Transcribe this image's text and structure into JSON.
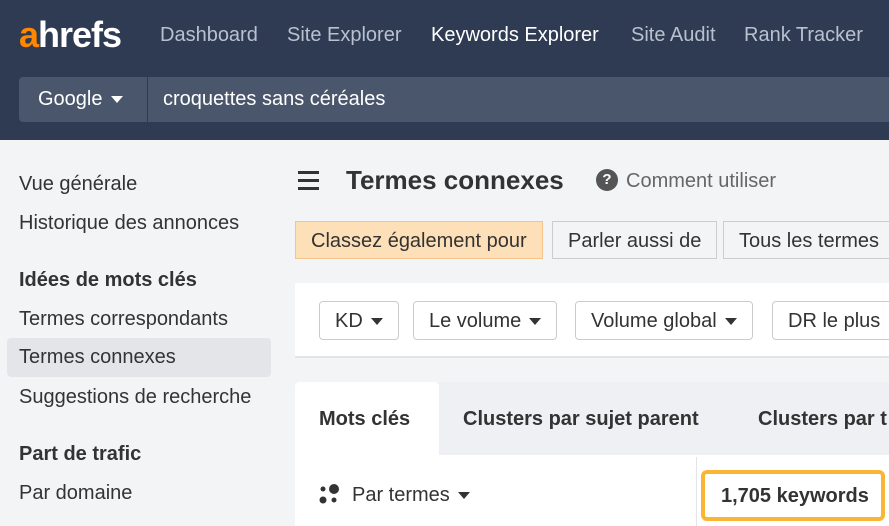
{
  "header": {
    "logo": "ahrefs",
    "nav": [
      "Dashboard",
      "Site Explorer",
      "Keywords Explorer",
      "Site Audit",
      "Rank Tracker"
    ],
    "active_nav": "Keywords Explorer",
    "engine": "Google",
    "query": "croquettes sans céréales"
  },
  "sidebar": {
    "items": [
      "Vue générale",
      "Historique des annonces"
    ],
    "section1": "Idées de mots clés",
    "section1_items": [
      "Termes correspondants",
      "Termes connexes",
      "Suggestions de recherche"
    ],
    "section2": "Part de trafic",
    "section2_items": [
      "Par domaine"
    ]
  },
  "main": {
    "title": "Termes connexes",
    "help": "Comment utiliser",
    "segments": [
      "Classez également pour",
      "Parler aussi de",
      "Tous les termes"
    ],
    "filters": [
      "KD",
      "Le volume",
      "Volume global",
      "DR le plus"
    ],
    "tabs": [
      "Mots clés",
      "Clusters par sujet parent",
      "Clusters par t"
    ],
    "group_by": "Par termes",
    "count": "1,705 keywords"
  },
  "colors": {
    "accent": "#ff8800",
    "highlight": "#fbb534",
    "header": "#2e3b52"
  }
}
